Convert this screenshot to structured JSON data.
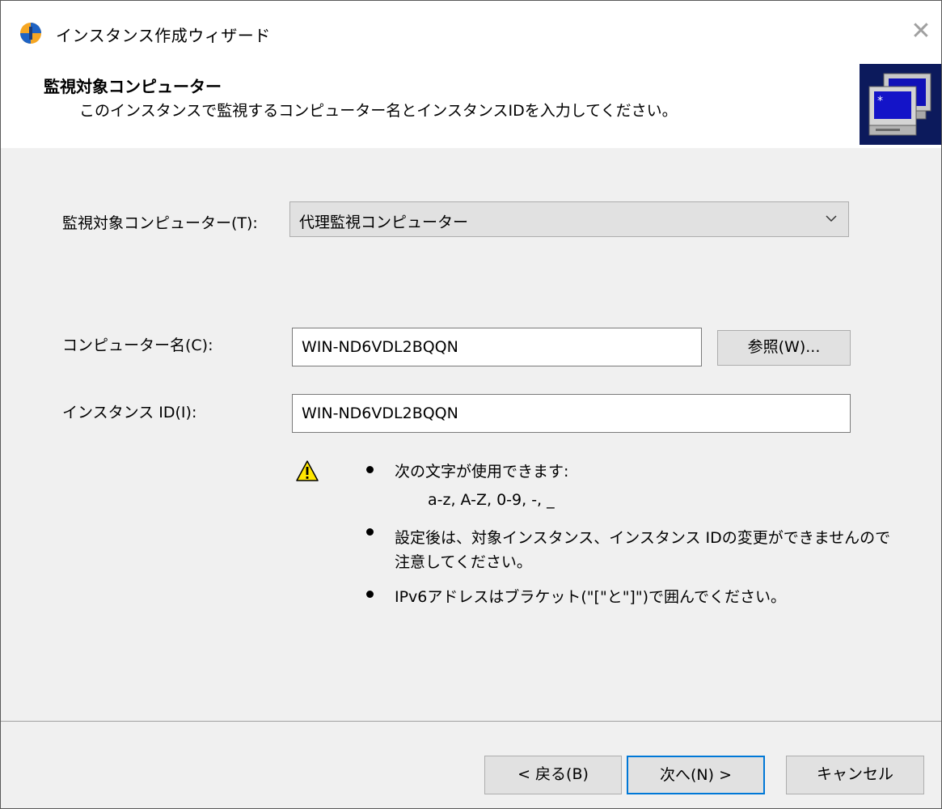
{
  "window": {
    "title": "インスタンス作成ウィザード",
    "close_glyph": "✕"
  },
  "header": {
    "title": "監視対象コンピューター",
    "subtitle": "このインスタンスで監視するコンピューター名とインスタンスIDを入力してください。",
    "icon": "monitored-computers-icon"
  },
  "form": {
    "target_label": "監視対象コンピューター(T):",
    "target_value": "代理監視コンピューター",
    "computer_name_label": "コンピューター名(C):",
    "computer_name_value": "WIN-ND6VDL2BQQN",
    "browse_button": "参照(W)...",
    "instance_id_label": "インスタンス ID(I):",
    "instance_id_value": "WIN-ND6VDL2BQQN"
  },
  "notes": {
    "icon": "warning-icon",
    "item1_line1": "次の文字が使用できます:",
    "item1_line2": "a-z, A-Z, 0-9, -, _",
    "item2_line1": "設定後は、対象インスタンス、インスタンス IDの変更ができませんので",
    "item2_line2": "注意してください。",
    "item3": "IPv6アドレスはブラケット(\"[\"と\"]\")で囲んでください。"
  },
  "buttons": {
    "back": "< 戻る(B)",
    "next": "次へ(N) >",
    "cancel": "キャンセル"
  },
  "colors": {
    "accent": "#0078d7",
    "dialog_bg": "#f0f0f0",
    "button_bg": "#e1e1e1",
    "warning": "#ffe600"
  }
}
